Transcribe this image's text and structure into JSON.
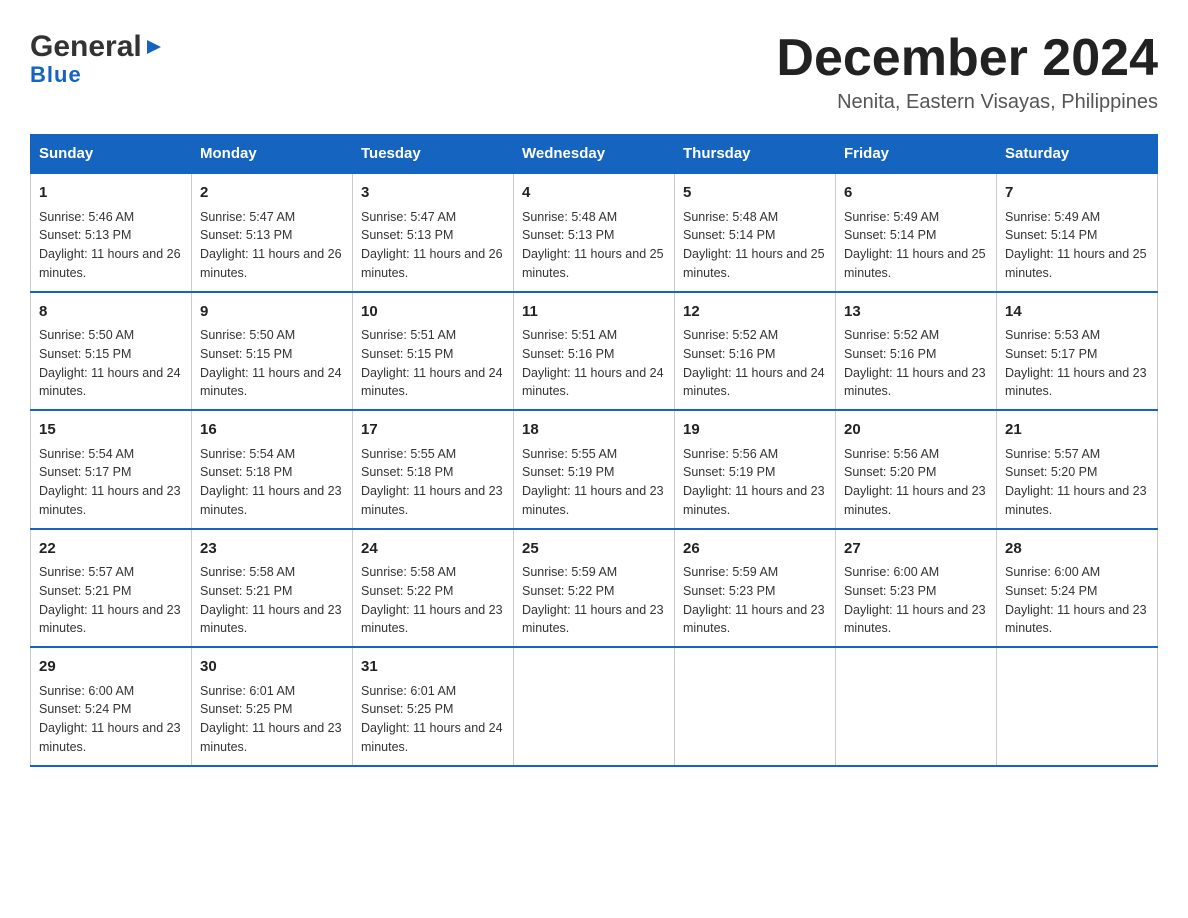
{
  "header": {
    "logo_general": "General",
    "logo_blue": "Blue",
    "month_title": "December 2024",
    "location": "Nenita, Eastern Visayas, Philippines"
  },
  "weekdays": [
    "Sunday",
    "Monday",
    "Tuesday",
    "Wednesday",
    "Thursday",
    "Friday",
    "Saturday"
  ],
  "weeks": [
    [
      {
        "day": "1",
        "sunrise": "5:46 AM",
        "sunset": "5:13 PM",
        "daylight": "11 hours and 26 minutes."
      },
      {
        "day": "2",
        "sunrise": "5:47 AM",
        "sunset": "5:13 PM",
        "daylight": "11 hours and 26 minutes."
      },
      {
        "day": "3",
        "sunrise": "5:47 AM",
        "sunset": "5:13 PM",
        "daylight": "11 hours and 26 minutes."
      },
      {
        "day": "4",
        "sunrise": "5:48 AM",
        "sunset": "5:13 PM",
        "daylight": "11 hours and 25 minutes."
      },
      {
        "day": "5",
        "sunrise": "5:48 AM",
        "sunset": "5:14 PM",
        "daylight": "11 hours and 25 minutes."
      },
      {
        "day": "6",
        "sunrise": "5:49 AM",
        "sunset": "5:14 PM",
        "daylight": "11 hours and 25 minutes."
      },
      {
        "day": "7",
        "sunrise": "5:49 AM",
        "sunset": "5:14 PM",
        "daylight": "11 hours and 25 minutes."
      }
    ],
    [
      {
        "day": "8",
        "sunrise": "5:50 AM",
        "sunset": "5:15 PM",
        "daylight": "11 hours and 24 minutes."
      },
      {
        "day": "9",
        "sunrise": "5:50 AM",
        "sunset": "5:15 PM",
        "daylight": "11 hours and 24 minutes."
      },
      {
        "day": "10",
        "sunrise": "5:51 AM",
        "sunset": "5:15 PM",
        "daylight": "11 hours and 24 minutes."
      },
      {
        "day": "11",
        "sunrise": "5:51 AM",
        "sunset": "5:16 PM",
        "daylight": "11 hours and 24 minutes."
      },
      {
        "day": "12",
        "sunrise": "5:52 AM",
        "sunset": "5:16 PM",
        "daylight": "11 hours and 24 minutes."
      },
      {
        "day": "13",
        "sunrise": "5:52 AM",
        "sunset": "5:16 PM",
        "daylight": "11 hours and 23 minutes."
      },
      {
        "day": "14",
        "sunrise": "5:53 AM",
        "sunset": "5:17 PM",
        "daylight": "11 hours and 23 minutes."
      }
    ],
    [
      {
        "day": "15",
        "sunrise": "5:54 AM",
        "sunset": "5:17 PM",
        "daylight": "11 hours and 23 minutes."
      },
      {
        "day": "16",
        "sunrise": "5:54 AM",
        "sunset": "5:18 PM",
        "daylight": "11 hours and 23 minutes."
      },
      {
        "day": "17",
        "sunrise": "5:55 AM",
        "sunset": "5:18 PM",
        "daylight": "11 hours and 23 minutes."
      },
      {
        "day": "18",
        "sunrise": "5:55 AM",
        "sunset": "5:19 PM",
        "daylight": "11 hours and 23 minutes."
      },
      {
        "day": "19",
        "sunrise": "5:56 AM",
        "sunset": "5:19 PM",
        "daylight": "11 hours and 23 minutes."
      },
      {
        "day": "20",
        "sunrise": "5:56 AM",
        "sunset": "5:20 PM",
        "daylight": "11 hours and 23 minutes."
      },
      {
        "day": "21",
        "sunrise": "5:57 AM",
        "sunset": "5:20 PM",
        "daylight": "11 hours and 23 minutes."
      }
    ],
    [
      {
        "day": "22",
        "sunrise": "5:57 AM",
        "sunset": "5:21 PM",
        "daylight": "11 hours and 23 minutes."
      },
      {
        "day": "23",
        "sunrise": "5:58 AM",
        "sunset": "5:21 PM",
        "daylight": "11 hours and 23 minutes."
      },
      {
        "day": "24",
        "sunrise": "5:58 AM",
        "sunset": "5:22 PM",
        "daylight": "11 hours and 23 minutes."
      },
      {
        "day": "25",
        "sunrise": "5:59 AM",
        "sunset": "5:22 PM",
        "daylight": "11 hours and 23 minutes."
      },
      {
        "day": "26",
        "sunrise": "5:59 AM",
        "sunset": "5:23 PM",
        "daylight": "11 hours and 23 minutes."
      },
      {
        "day": "27",
        "sunrise": "6:00 AM",
        "sunset": "5:23 PM",
        "daylight": "11 hours and 23 minutes."
      },
      {
        "day": "28",
        "sunrise": "6:00 AM",
        "sunset": "5:24 PM",
        "daylight": "11 hours and 23 minutes."
      }
    ],
    [
      {
        "day": "29",
        "sunrise": "6:00 AM",
        "sunset": "5:24 PM",
        "daylight": "11 hours and 23 minutes."
      },
      {
        "day": "30",
        "sunrise": "6:01 AM",
        "sunset": "5:25 PM",
        "daylight": "11 hours and 23 minutes."
      },
      {
        "day": "31",
        "sunrise": "6:01 AM",
        "sunset": "5:25 PM",
        "daylight": "11 hours and 24 minutes."
      },
      null,
      null,
      null,
      null
    ]
  ],
  "labels": {
    "sunrise_prefix": "Sunrise: ",
    "sunset_prefix": "Sunset: ",
    "daylight_prefix": "Daylight: "
  }
}
